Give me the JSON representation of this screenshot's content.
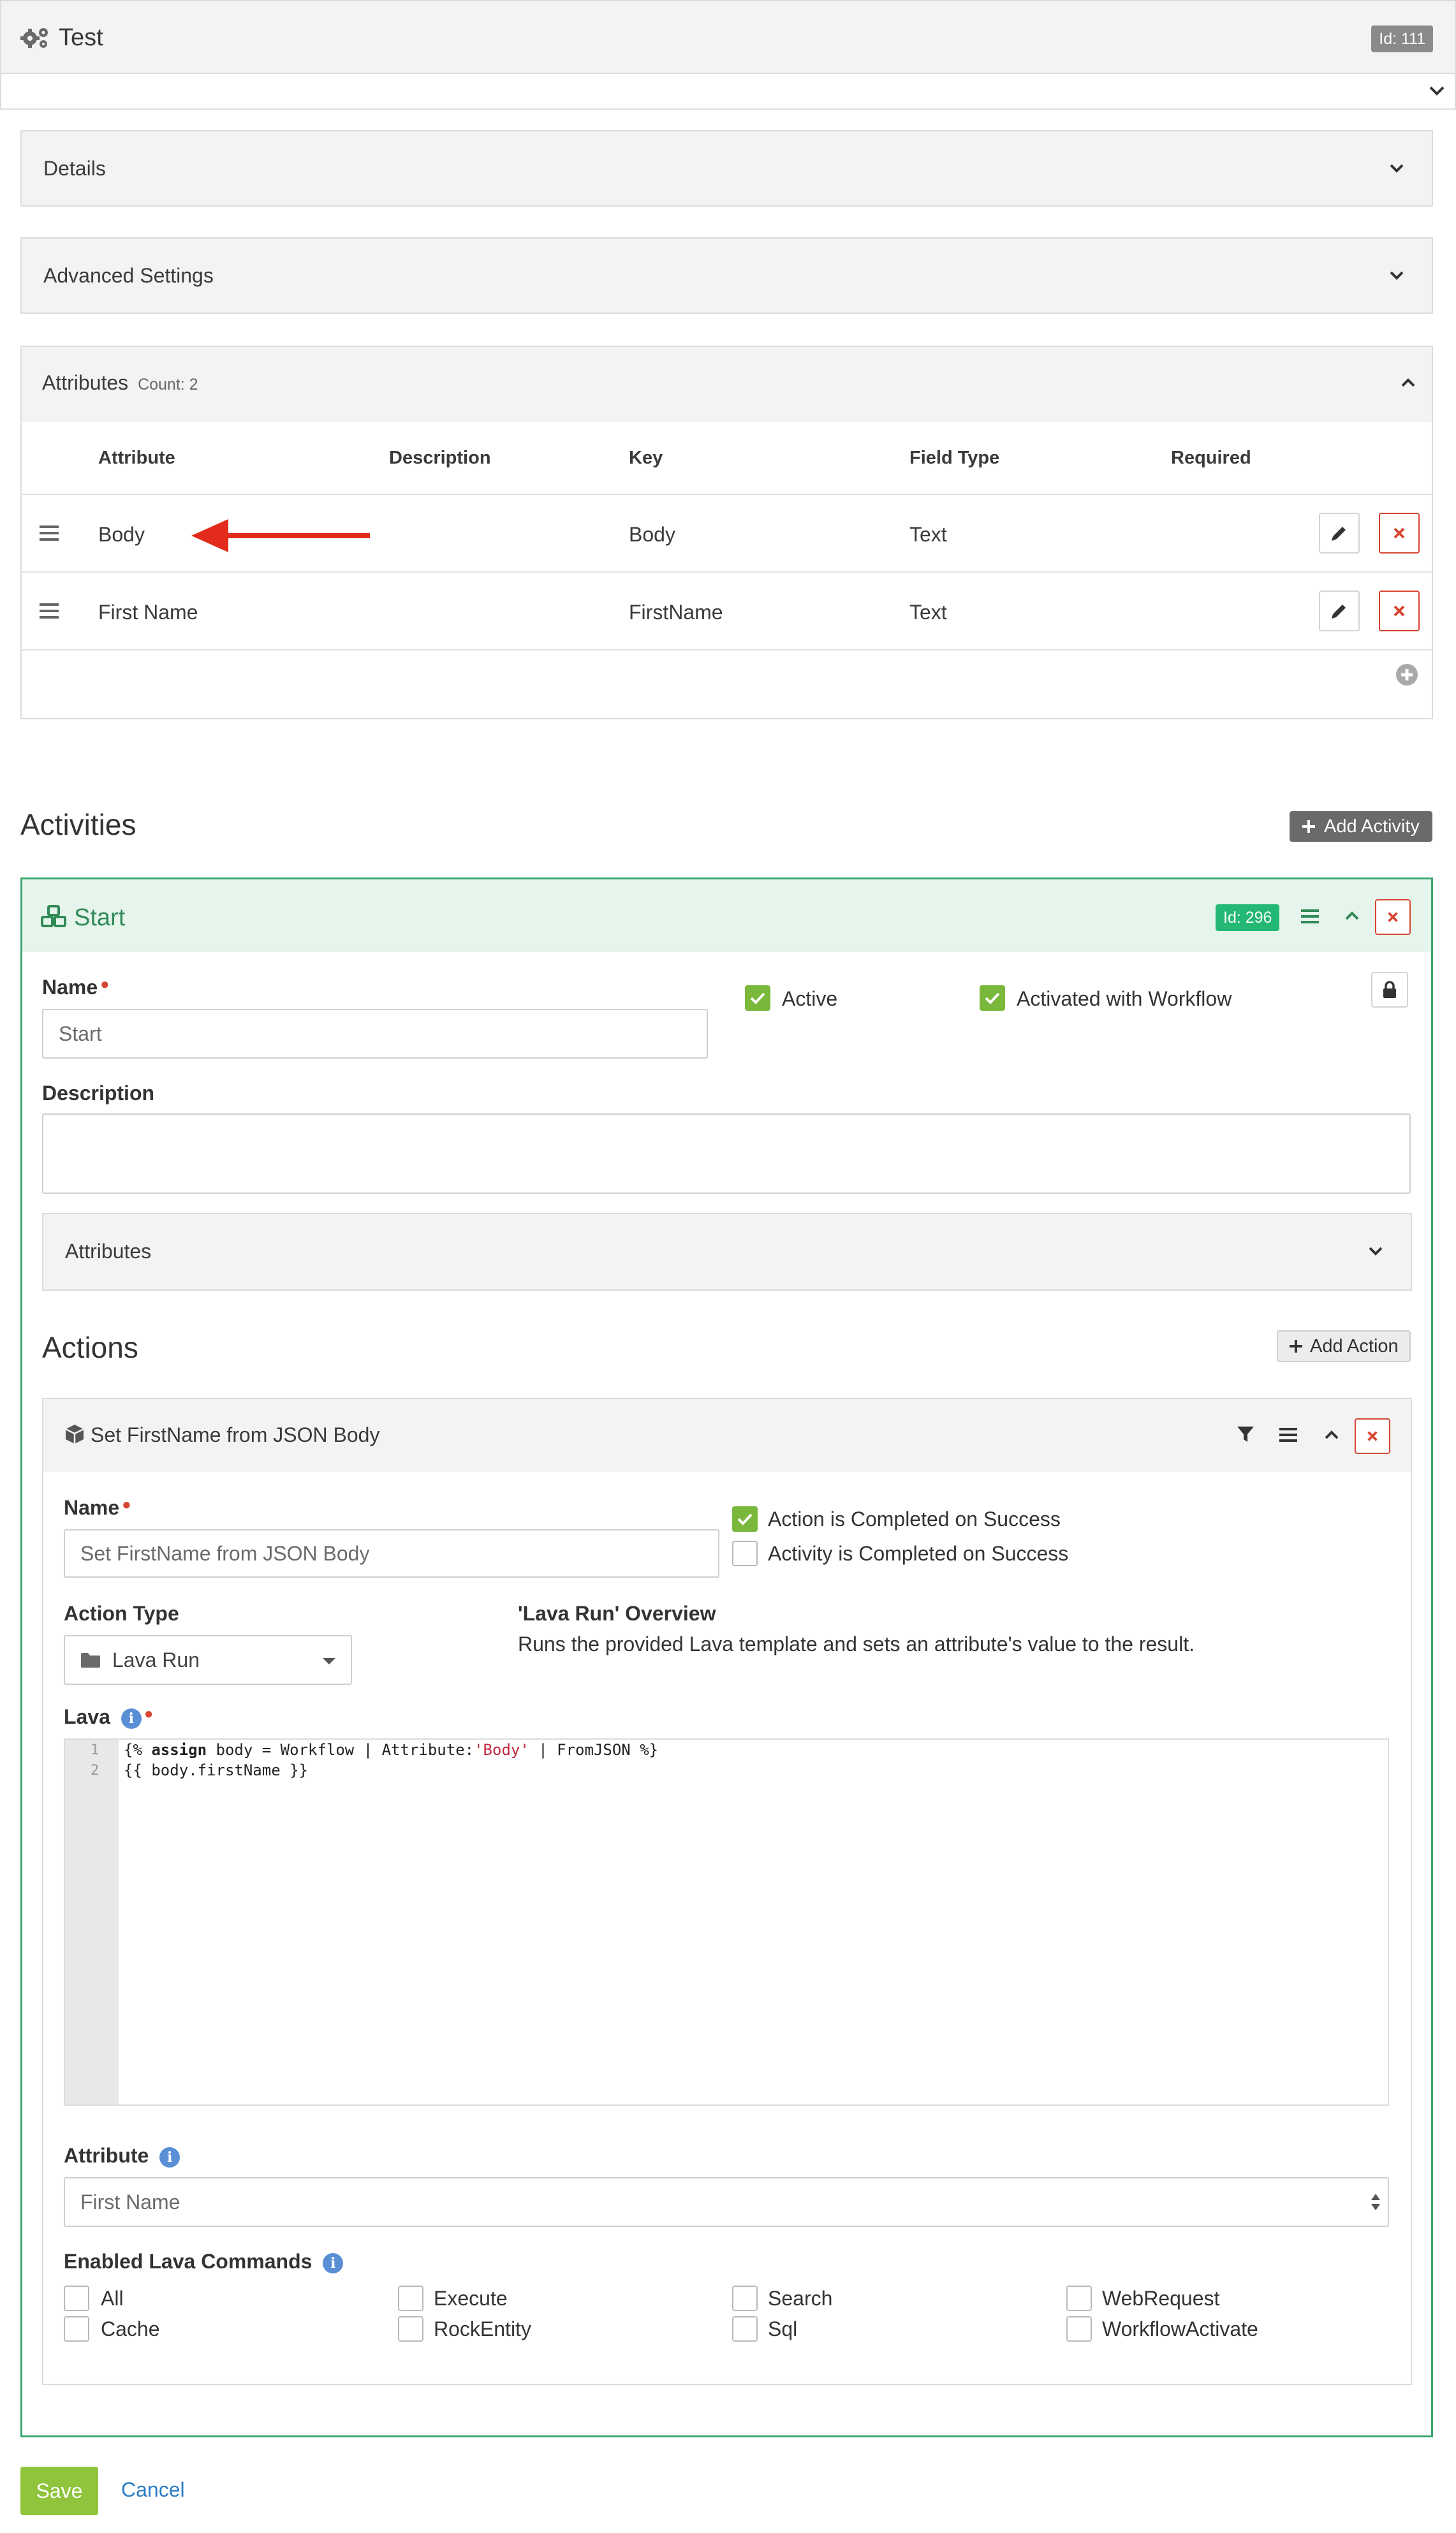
{
  "workflow": {
    "title": "Test",
    "id_badge": "Id: 111"
  },
  "panels": {
    "details": "Details",
    "advanced": "Advanced Settings"
  },
  "attributes": {
    "title": "Attributes",
    "count": "Count: 2",
    "columns": [
      "Attribute",
      "Description",
      "Key",
      "Field Type",
      "Required"
    ],
    "rows": [
      {
        "attribute": "Body",
        "description": "",
        "key": "Body",
        "field_type": "Text"
      },
      {
        "attribute": "First Name",
        "description": "",
        "key": "FirstName",
        "field_type": "Text"
      }
    ]
  },
  "activities": {
    "title": "Activities",
    "add_label": "Add Activity",
    "activity": {
      "title": "Start",
      "id_badge": "Id: 296",
      "name_label": "Name",
      "name_value": "Start",
      "active_label": "Active",
      "activated_label": "Activated with Workflow",
      "description_label": "Description",
      "description_value": "",
      "attributes_label": "Attributes"
    }
  },
  "actions": {
    "title": "Actions",
    "add_label": "Add Action",
    "action": {
      "title": "Set FirstName from JSON Body",
      "name_label": "Name",
      "name_value": "Set FirstName from JSON Body",
      "completed_action": "Action is Completed on Success",
      "completed_activity": "Activity is Completed on Success",
      "action_type_label": "Action Type",
      "action_type_value": "Lava Run",
      "overview_title": "'Lava Run' Overview",
      "overview_text": "Runs the provided Lava template and sets an attribute's value to the result.",
      "lava_label": "Lava",
      "code_line_numbers": [
        "1",
        "2"
      ],
      "code": {
        "l1_a": "{% ",
        "l1_kw": "assign",
        "l1_b": " body = Workflow | Attribute:",
        "l1_str": "'Body'",
        "l1_c": " | FromJSON %}",
        "l2": "{{ body.firstName }}"
      },
      "attribute_label": "Attribute",
      "attribute_value": "First Name",
      "commands_label": "Enabled Lava Commands",
      "commands": [
        "All",
        "Cache",
        "Execute",
        "RockEntity",
        "Search",
        "Sql",
        "WebRequest",
        "WorkflowActivate"
      ]
    }
  },
  "footer": {
    "save": "Save",
    "cancel": "Cancel"
  }
}
